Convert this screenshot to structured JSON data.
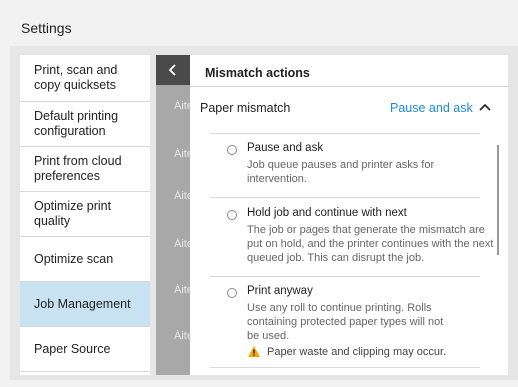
{
  "window": {
    "title": "Settings"
  },
  "sidebar": {
    "items": [
      {
        "label": "Print, scan and copy quicksets"
      },
      {
        "label": "Default printing configuration"
      },
      {
        "label": "Print from cloud preferences"
      },
      {
        "label": "Optimize print quality"
      },
      {
        "label": "Optimize scan"
      },
      {
        "label": "Job Management",
        "selected": true
      },
      {
        "label": "Paper Source"
      }
    ]
  },
  "middle": {
    "back_icon": "chevron-left-icon",
    "fragment": "Áite"
  },
  "panel": {
    "title": "Mismatch actions",
    "paper_mismatch": {
      "label": "Paper mismatch",
      "value": "Pause and ask",
      "icon": "chevron-up-icon"
    },
    "options": [
      {
        "title": "Pause and ask",
        "description": "Job queue pauses and printer asks for intervention."
      },
      {
        "title": "Hold job and continue with next",
        "description": "The job or pages that generate the mismatch are put on hold, and the printer continues with the next queued job. This can disrupt the job."
      },
      {
        "title": "Print anyway",
        "description": "Use any roll to continue printing. Rolls containing protected paper types will not be used.",
        "warning": "Paper waste and clipping may occur."
      }
    ]
  },
  "colors": {
    "accent": "#1a8cd8",
    "selected_bg": "#c9e2f1",
    "warning": "#f2a900"
  }
}
